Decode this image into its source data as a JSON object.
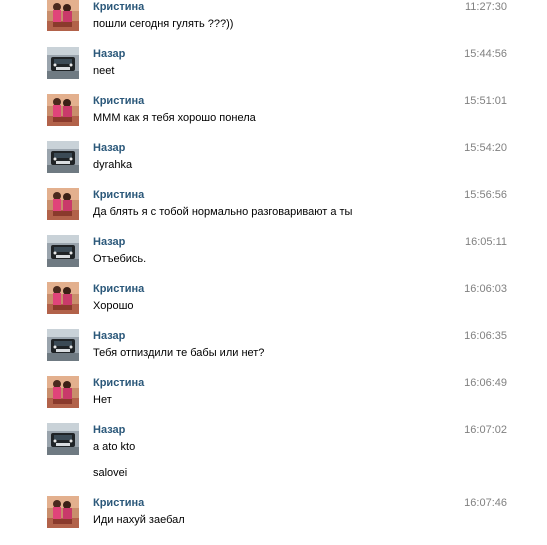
{
  "messages": [
    {
      "author": "Кристина",
      "avatar": "kristina-avatar",
      "time": "11:27:30",
      "lines": [
        "пошли сегодня гулять ???))"
      ]
    },
    {
      "author": "Назар",
      "avatar": "nazar-avatar",
      "time": "15:44:56",
      "lines": [
        "neet"
      ]
    },
    {
      "author": "Кристина",
      "avatar": "kristina-avatar",
      "time": "15:51:01",
      "lines": [
        "МММ как я тебя хорошо понела"
      ]
    },
    {
      "author": "Назар",
      "avatar": "nazar-avatar",
      "time": "15:54:20",
      "lines": [
        "dyrahka"
      ]
    },
    {
      "author": "Кристина",
      "avatar": "kristina-avatar",
      "time": "15:56:56",
      "lines": [
        "Да блять я с тобой нормально разговаривают а ты"
      ]
    },
    {
      "author": "Назар",
      "avatar": "nazar-avatar",
      "time": "16:05:11",
      "lines": [
        "Отъебись."
      ]
    },
    {
      "author": "Кристина",
      "avatar": "kristina-avatar",
      "time": "16:06:03",
      "lines": [
        "Хорошо"
      ]
    },
    {
      "author": "Назар",
      "avatar": "nazar-avatar",
      "time": "16:06:35",
      "lines": [
        "Тебя отпиздили те бабы или нет?"
      ]
    },
    {
      "author": "Кристина",
      "avatar": "kristina-avatar",
      "time": "16:06:49",
      "lines": [
        "Нет"
      ]
    },
    {
      "author": "Назар",
      "avatar": "nazar-avatar",
      "time": "16:07:02",
      "lines": [
        "a ato kto",
        "salovei"
      ]
    },
    {
      "author": "Кристина",
      "avatar": "kristina-avatar",
      "time": "16:07:46",
      "lines": [
        "Иди нахуй заебал"
      ]
    }
  ],
  "colors": {
    "author": "#2b587a",
    "time": "#808080",
    "text": "#000000",
    "background": "#ffffff"
  }
}
